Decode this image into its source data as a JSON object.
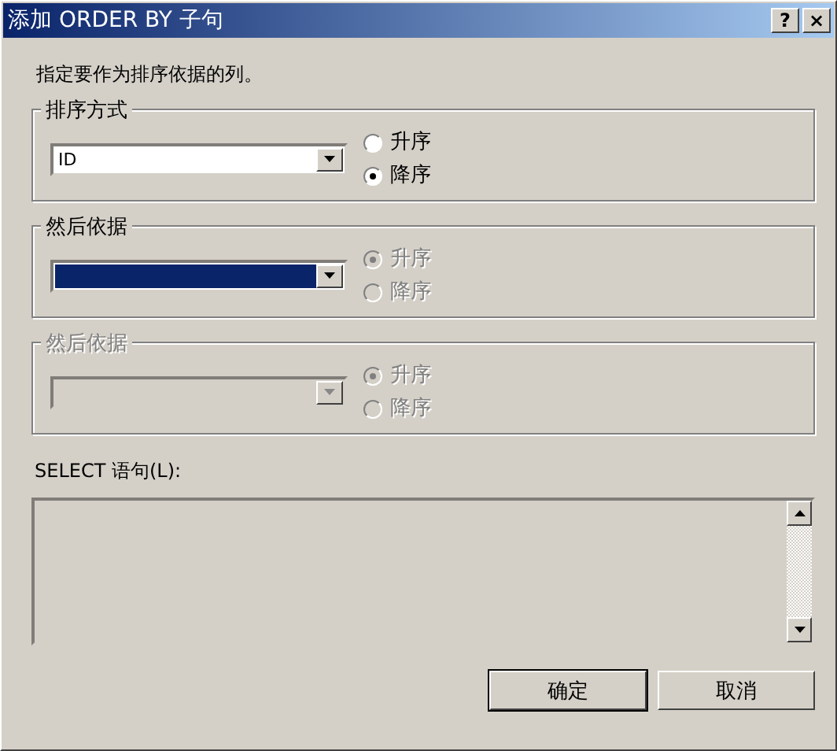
{
  "window": {
    "title": "添加 ORDER BY 子句",
    "buttons": [
      "?",
      "×"
    ]
  },
  "instruction": "指定要作为排序依据的列。",
  "groups": [
    {
      "legend": "排序方式",
      "disabled": false,
      "dropdown": {
        "value": "ID",
        "focused": false,
        "disabled": false
      },
      "options": [
        {
          "label": "升序",
          "selected": false,
          "disabled": false
        },
        {
          "label": "降序",
          "selected": true,
          "disabled": false
        }
      ]
    },
    {
      "legend": "然后依据",
      "disabled": false,
      "dropdown": {
        "focused": true,
        "disabled": false
      },
      "options": [
        {
          "label": "升序",
          "selected": true,
          "disabled": true
        },
        {
          "label": "降序",
          "selected": false,
          "disabled": true
        }
      ]
    },
    {
      "legend": "然后依据",
      "disabled": true,
      "dropdown": {
        "focused": false,
        "disabled": true
      },
      "options": [
        {
          "label": "升序",
          "selected": true,
          "disabled": true
        },
        {
          "label": "降序",
          "selected": false,
          "disabled": true
        }
      ]
    }
  ],
  "select_label": "SELECT 语句(L):",
  "buttons": [
    {
      "label": "确定",
      "default": true
    },
    {
      "label": "取消",
      "default": false
    }
  ]
}
